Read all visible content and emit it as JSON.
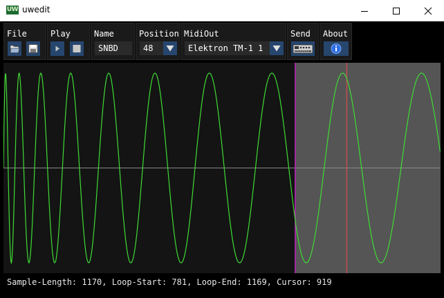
{
  "window": {
    "title": "uwedit",
    "logo_text": "UW"
  },
  "toolbar": {
    "file_label": "File",
    "play_label": "Play",
    "name_label": "Name",
    "name_value": "SNBD",
    "position_label": "Position",
    "position_value": "48",
    "midiout_label": "MidiOut",
    "midiout_value": "Elektron TM-1 1",
    "send_label": "Send",
    "about_label": "About"
  },
  "waveform": {
    "sample_length": 1170,
    "loop_start": 781,
    "loop_end": 1169,
    "cursor": 919,
    "colors": {
      "wave": "#3fdc35",
      "loop_region": "#555555",
      "loop_start_marker": "#c020c0",
      "cursor_marker": "#c05050",
      "zero_line": "#8a8a8a",
      "background": "#141414"
    }
  },
  "status_text": "Sample-Length: 1170, Loop-Start: 781, Loop-End: 1169, Cursor: 919",
  "icons": [
    "open-folder-icon",
    "save-icon",
    "play-icon",
    "stop-icon",
    "synth-device-icon",
    "info-icon"
  ]
}
